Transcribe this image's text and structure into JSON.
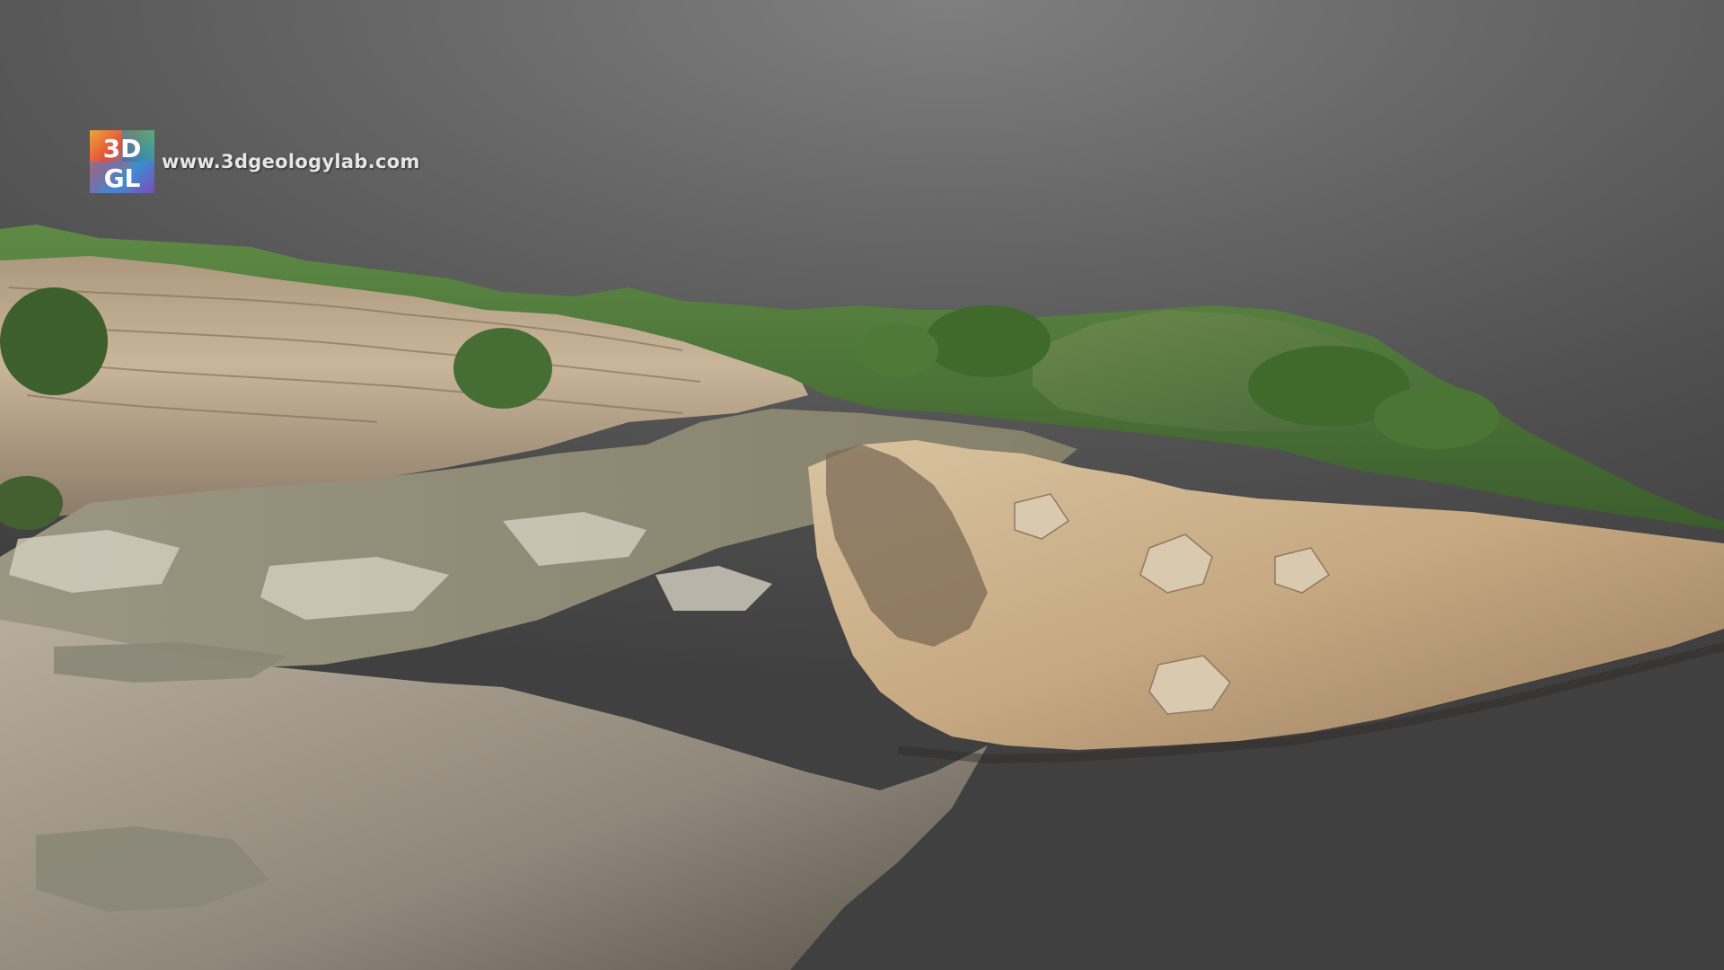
{
  "watermark": {
    "logo_top": "3D",
    "logo_bottom": "GL",
    "url": "www.3dgeologylab.com"
  },
  "scene": {
    "subject": "3d-cliff-outcrop-model",
    "background_color": "#5a5a5a",
    "vegetation_color": "#4f7a3a",
    "rock_color": "#c8b394",
    "sediment_color": "#8f8f7a"
  }
}
